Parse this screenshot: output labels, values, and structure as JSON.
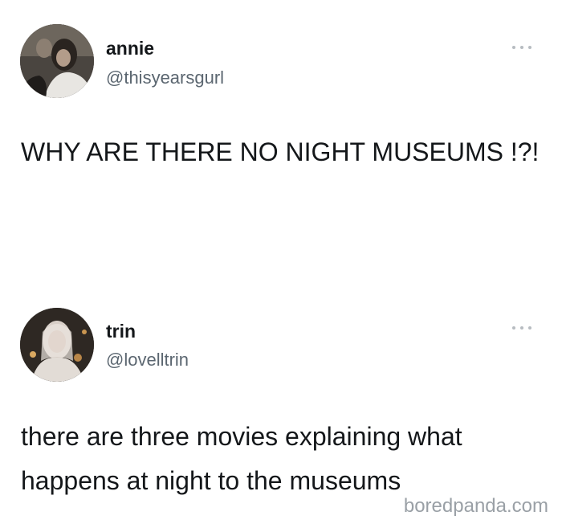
{
  "tweets": [
    {
      "name": "annie",
      "handle": "@thisyearsgurl",
      "text": "WHY ARE THERE NO NIGHT MUSEUMS !?!",
      "avatar_icon": "profile-photo"
    },
    {
      "name": "trin",
      "handle": "@lovelltrin",
      "text": "there are three movies explaining what happens at night to the museums",
      "avatar_icon": "profile-photo"
    }
  ],
  "watermark": "boredpanda.com",
  "colors": {
    "text": "#14171a",
    "secondary": "#5b6670",
    "more_dots": "#b7bcc1",
    "watermark": "#9aa0a6"
  }
}
